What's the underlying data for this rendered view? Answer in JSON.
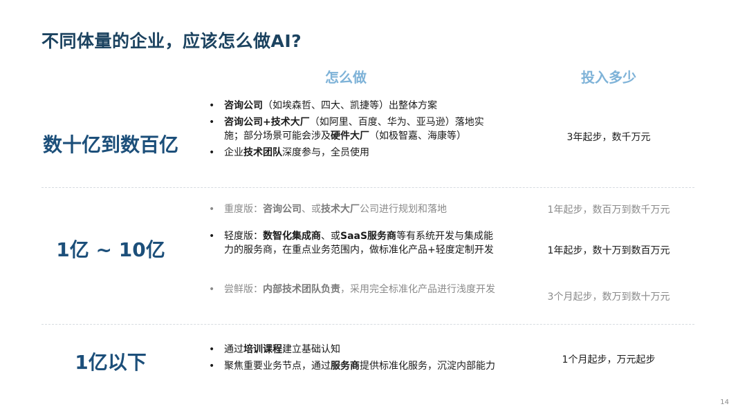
{
  "title": "不同体量的企业，应该怎么做AI?",
  "headers": {
    "how": "怎么做",
    "cost": "投入多少"
  },
  "tiers": [
    {
      "label": "数十亿到数百亿"
    },
    {
      "label": "1亿 ~ 10亿"
    },
    {
      "label": "1亿以下"
    }
  ],
  "tier1": {
    "b1": {
      "s1": "咨询公司",
      "s2": "（如埃森哲、四大、凯捷等）出整体方案"
    },
    "b2": {
      "s1": "咨询公司+技术大厂",
      "s2": "（如阿里、百度、华为、亚马逊）落地实施；部分场景可能会涉及",
      "s3": "硬件大厂",
      "s4": "（如极智嘉、海康等）"
    },
    "b3": {
      "s1": "企业",
      "s2": "技术团队",
      "s3": "深度参与，全员使用"
    },
    "cost": "3年起步，数千万元"
  },
  "tier2": {
    "a": {
      "s1": "重度版：",
      "s2": "咨询公司",
      "s3": "、或",
      "s4": "技术大厂",
      "s5": "公司进行规划和落地",
      "cost": "1年起步，数百万到数千万元"
    },
    "b": {
      "s1": "轻度版：",
      "s2": "数智化集成商",
      "s3": "、或",
      "s4": "SaaS服务商",
      "s5": "等有系统开发与集成能力的服务商，在重点业务范围内，做标准化产品+轻度定制开发",
      "cost": "1年起步，数十万到数百万元"
    },
    "c": {
      "s1": "尝鲜版：",
      "s2": "内部技术团队负责",
      "s3": "，采用完全标准化产品进行浅度开发",
      "cost": "3个月起步，数万到数十万元"
    }
  },
  "tier3": {
    "b1": {
      "s1": "通过",
      "s2": "培训课程",
      "s3": "建立基础认知"
    },
    "b2": {
      "s1": "聚焦重要业务节点，通过",
      "s2": "服务商",
      "s3": "提供标准化服务，沉淀内部能力"
    },
    "cost": "1个月起步，万元起步"
  },
  "page_number": "14"
}
